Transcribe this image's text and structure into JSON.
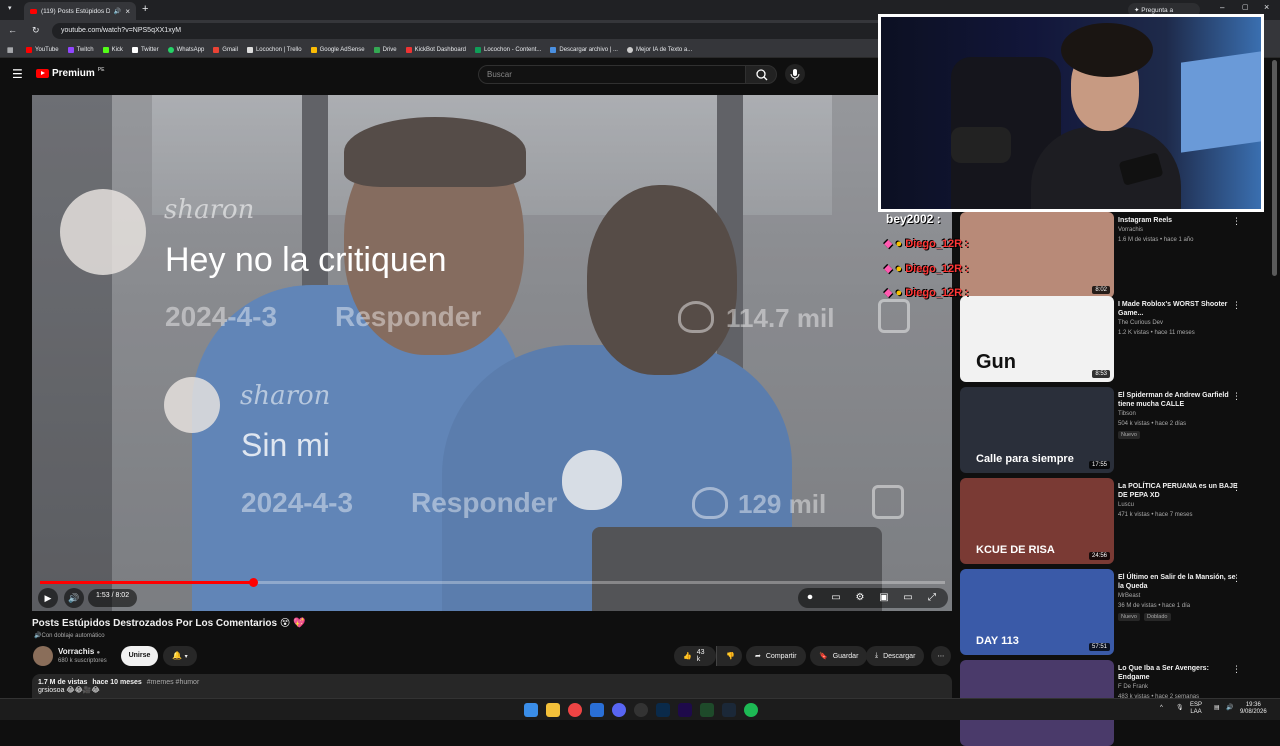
{
  "browser": {
    "tab_title": "(119) Posts Estúpidos Destr",
    "url": "youtube.com/watch?v=NPS5qXX1xyM",
    "gemini_label": "Pregunta a Gemini",
    "bookmarks": [
      "YouTube",
      "Twitch",
      "Kick",
      "Twitter",
      "WhatsApp",
      "Gmail",
      "Locochon | Trello",
      "Google AdSense",
      "Drive",
      "KickBot Dashboard",
      "Locochon - Content...",
      "Descargar archivo | ...",
      "Mejor IA de Texto a..."
    ]
  },
  "header": {
    "logo_label": "Premium",
    "logo_country": "PE",
    "search_placeholder": "Buscar"
  },
  "video_overlay": {
    "comments": [
      {
        "name": "sharon",
        "text": "Hey no la critiquen",
        "date": "2024-4-3",
        "reply": "Responder",
        "likes": "114.7 mil"
      },
      {
        "name": "sharon",
        "text": "Sin mi",
        "date": "2024-4-3",
        "reply": "Responder",
        "likes": "129 mil"
      }
    ]
  },
  "player": {
    "time": "1:53 / 8:02",
    "progress_fraction": 0.235
  },
  "video": {
    "title": "Posts Estúpidos Destrozados Por Los Comentarios",
    "dubbed": "Con doblaje automático",
    "channel": "Vorrachis",
    "subscribers": "680 k suscriptores",
    "join_label": "Unirse",
    "likes": "43 k",
    "share_label": "Compartir",
    "save_label": "Guardar",
    "download_label": "Descargar",
    "views": "1.7 M de vistas",
    "age": "hace 10 meses",
    "tags": "#memes #humor",
    "desc_line": "grsiosoa"
  },
  "chat": {
    "top": "bey2002 :",
    "lines": [
      "Diego_12R :",
      "Diego_12R :",
      "Diego_12R :"
    ]
  },
  "sidebar": [
    {
      "title": "Instagram Reels",
      "channel": "Vorrachis",
      "meta": "1.6 M de vistas • hace 1 año",
      "duration": "8:02",
      "thumb_color": "#b88a78",
      "thumb_text": ""
    },
    {
      "title": "I Made Roblox's WORST Shooter Game...",
      "channel": "The Curious Dev",
      "meta": "1.2 K vistas • hace 11 meses",
      "duration": "8:53",
      "thumb_color": "#f2f2f2",
      "thumb_text": "Gun"
    },
    {
      "title": "El Spiderman de Andrew Garfield tiene mucha CALLE",
      "channel": "Tibson",
      "meta": "504 k vistas • hace 2 días",
      "duration": "17:55",
      "thumb_color": "#2a2f3a",
      "thumb_text": "Calle para siempre",
      "badge": "Nuevo"
    },
    {
      "title": "La POLÍTICA PERUANA es un BAJE DE PEPA XD",
      "channel": "Luscu",
      "meta": "471 k vistas • hace 7 meses",
      "duration": "24:56",
      "thumb_color": "#7a3a34",
      "thumb_text": "KCUE DE RISA"
    },
    {
      "title": "El Último en Salir de la Mansión, se la Queda",
      "channel": "MrBeast",
      "meta": "36 M de vistas • hace 1 día",
      "duration": "57:51",
      "thumb_color": "#3a5aa8",
      "thumb_text": "DAY 113",
      "badge": "Nuevo",
      "badge2": "Doblado"
    },
    {
      "title": "Lo Que Iba a Ser Avengers: Endgame",
      "channel": "F De Frank",
      "meta": "483 k vistas • hace 2 semanas",
      "duration": "",
      "thumb_color": "#4a3a6a",
      "thumb_text": ""
    }
  ],
  "taskbar": {
    "lang": "ESP",
    "lang2": "LAA",
    "time": "19:36",
    "date": "9/08/2026"
  },
  "colors": {
    "accent": "#ff0000",
    "chat_name": "#ff3636"
  }
}
